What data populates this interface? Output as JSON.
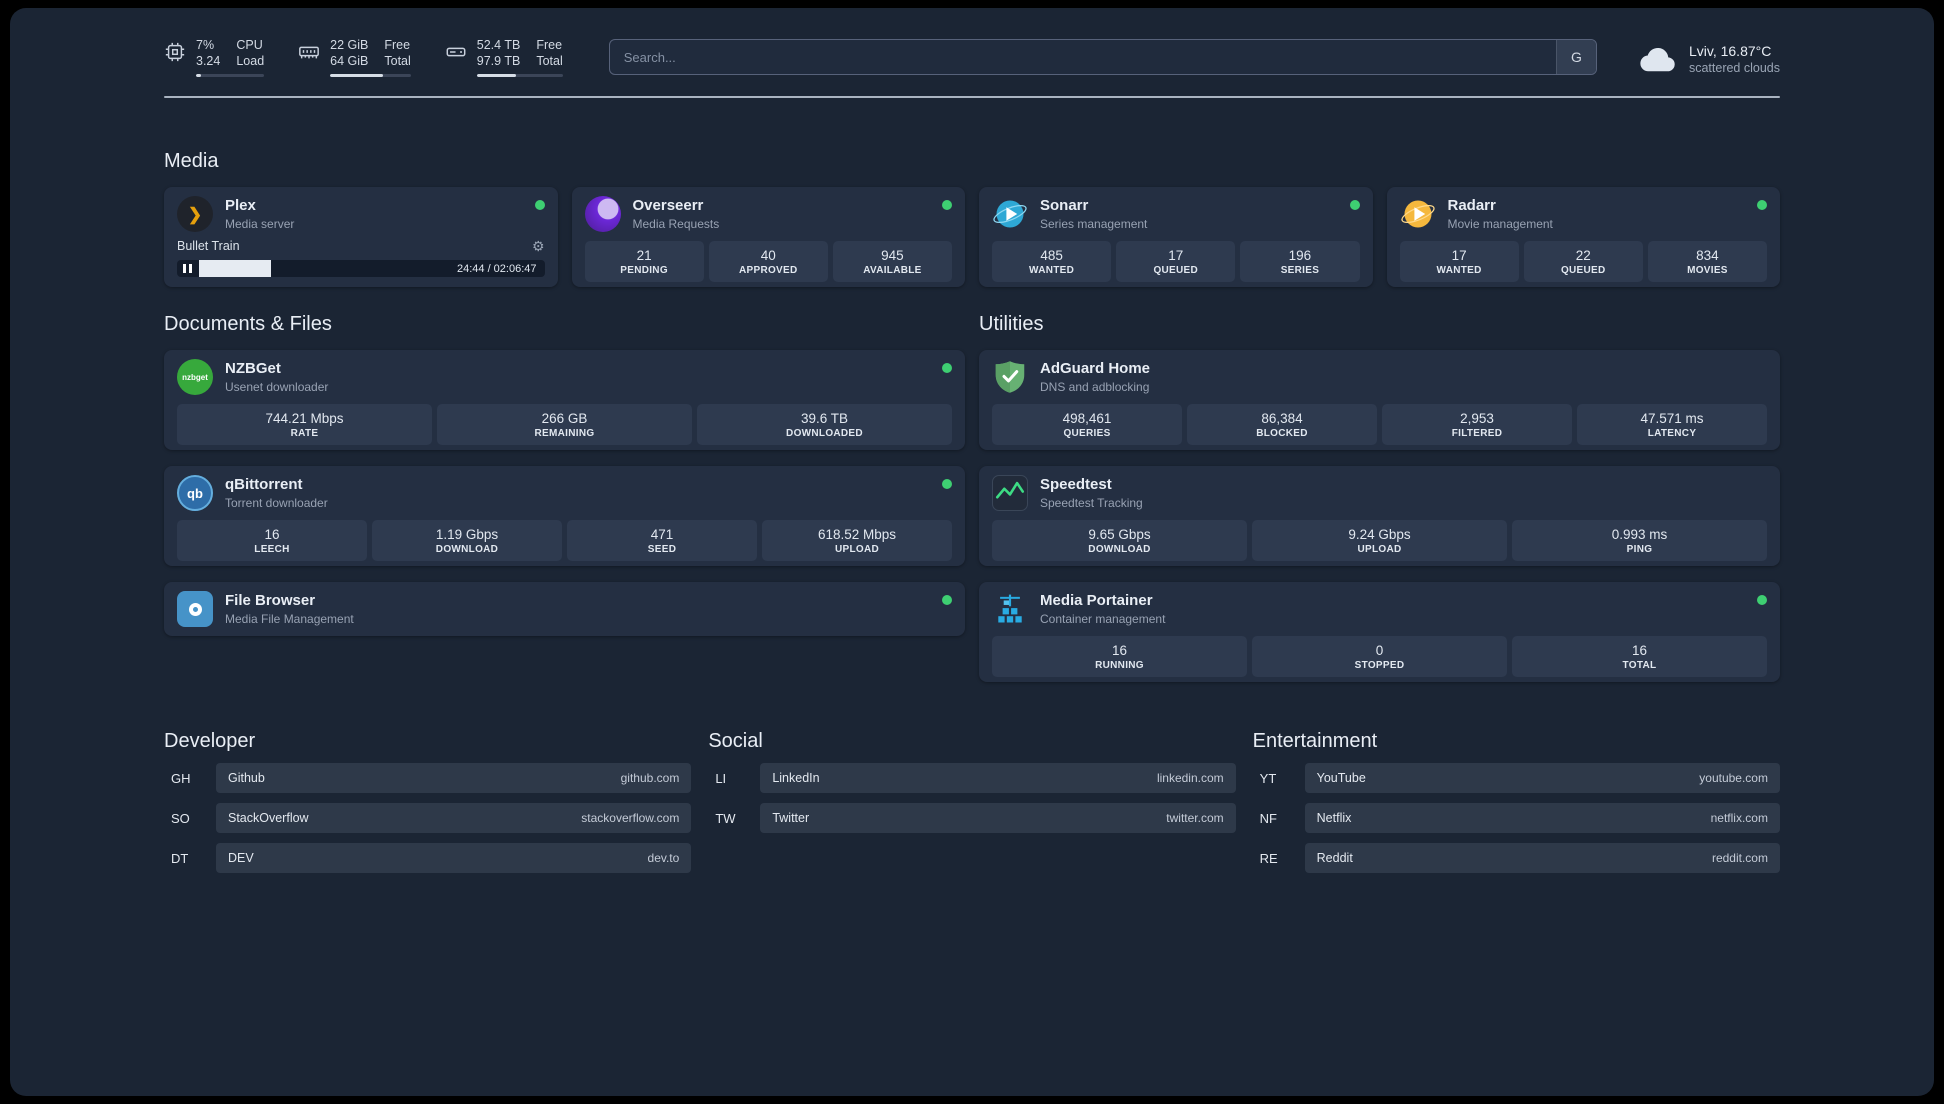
{
  "topbar": {
    "cpu": {
      "value_top": "7%",
      "value_bottom": "3.24",
      "label_top": "CPU",
      "label_bottom": "Load",
      "bar_percent": 7
    },
    "memory": {
      "value_top": "22 GiB",
      "value_bottom": "64 GiB",
      "label_top": "Free",
      "label_bottom": "Total",
      "bar_percent": 66
    },
    "disk": {
      "value_top": "52.4 TB",
      "value_bottom": "97.9 TB",
      "label_top": "Free",
      "label_bottom": "Total",
      "bar_percent": 46
    },
    "search": {
      "placeholder": "Search...",
      "provider_label": "G"
    },
    "weather": {
      "location": "Lviv, 16.87°C",
      "condition": "scattered clouds"
    }
  },
  "sections": {
    "media": "Media",
    "documents": "Documents & Files",
    "utilities": "Utilities",
    "developer": "Developer",
    "social": "Social",
    "entertainment": "Entertainment"
  },
  "services": {
    "plex": {
      "name": "Plex",
      "subtitle": "Media server",
      "now_playing": "Bullet Train",
      "time": "24:44 / 02:06:47",
      "progress_percent": 19.5
    },
    "overseerr": {
      "name": "Overseerr",
      "subtitle": "Media Requests",
      "stats": [
        {
          "value": "21",
          "label": "PENDING"
        },
        {
          "value": "40",
          "label": "APPROVED"
        },
        {
          "value": "945",
          "label": "AVAILABLE"
        }
      ]
    },
    "sonarr": {
      "name": "Sonarr",
      "subtitle": "Series management",
      "stats": [
        {
          "value": "485",
          "label": "WANTED"
        },
        {
          "value": "17",
          "label": "QUEUED"
        },
        {
          "value": "196",
          "label": "SERIES"
        }
      ]
    },
    "radarr": {
      "name": "Radarr",
      "subtitle": "Movie management",
      "stats": [
        {
          "value": "17",
          "label": "WANTED"
        },
        {
          "value": "22",
          "label": "QUEUED"
        },
        {
          "value": "834",
          "label": "MOVIES"
        }
      ]
    },
    "nzbget": {
      "name": "NZBGet",
      "subtitle": "Usenet downloader",
      "icon_text": "nzbget",
      "stats": [
        {
          "value": "744.21 Mbps",
          "label": "RATE"
        },
        {
          "value": "266 GB",
          "label": "REMAINING"
        },
        {
          "value": "39.6 TB",
          "label": "DOWNLOADED"
        }
      ]
    },
    "qbittorrent": {
      "name": "qBittorrent",
      "subtitle": "Torrent downloader",
      "icon_text": "qb",
      "stats": [
        {
          "value": "16",
          "label": "LEECH"
        },
        {
          "value": "1.19 Gbps",
          "label": "DOWNLOAD"
        },
        {
          "value": "471",
          "label": "SEED"
        },
        {
          "value": "618.52 Mbps",
          "label": "UPLOAD"
        }
      ]
    },
    "filebrowser": {
      "name": "File Browser",
      "subtitle": "Media File Management"
    },
    "adguard": {
      "name": "AdGuard Home",
      "subtitle": "DNS and adblocking",
      "stats": [
        {
          "value": "498,461",
          "label": "QUERIES"
        },
        {
          "value": "86,384",
          "label": "BLOCKED"
        },
        {
          "value": "2,953",
          "label": "FILTERED"
        },
        {
          "value": "47.571 ms",
          "label": "LATENCY"
        }
      ]
    },
    "speedtest": {
      "name": "Speedtest",
      "subtitle": "Speedtest Tracking",
      "stats": [
        {
          "value": "9.65 Gbps",
          "label": "DOWNLOAD"
        },
        {
          "value": "9.24 Gbps",
          "label": "UPLOAD"
        },
        {
          "value": "0.993 ms",
          "label": "PING"
        }
      ]
    },
    "portainer": {
      "name": "Media Portainer",
      "subtitle": "Container management",
      "stats": [
        {
          "value": "16",
          "label": "RUNNING"
        },
        {
          "value": "0",
          "label": "STOPPED"
        },
        {
          "value": "16",
          "label": "TOTAL"
        }
      ]
    }
  },
  "bookmarks": {
    "developer": [
      {
        "abbr": "GH",
        "name": "Github",
        "url": "github.com"
      },
      {
        "abbr": "SO",
        "name": "StackOverflow",
        "url": "stackoverflow.com"
      },
      {
        "abbr": "DT",
        "name": "DEV",
        "url": "dev.to"
      }
    ],
    "social": [
      {
        "abbr": "LI",
        "name": "LinkedIn",
        "url": "linkedin.com"
      },
      {
        "abbr": "TW",
        "name": "Twitter",
        "url": "twitter.com"
      }
    ],
    "entertainment": [
      {
        "abbr": "YT",
        "name": "YouTube",
        "url": "youtube.com"
      },
      {
        "abbr": "NF",
        "name": "Netflix",
        "url": "netflix.com"
      },
      {
        "abbr": "RE",
        "name": "Reddit",
        "url": "reddit.com"
      }
    ]
  },
  "colors": {
    "status_online": "#3ecf72",
    "plex_amber": "#e5a00d",
    "overseerr_purple": "#6d28d9",
    "sonarr_blue": "#2ea8d5",
    "radarr_yellow": "#f5b83d",
    "nzbget_green": "#37a93c",
    "qbittorrent_blue": "#64aede",
    "adguard_green": "#67b173",
    "speedtest_green": "#3ddc84",
    "portainer_blue": "#29abe2",
    "filebrowser_blue": "#4693c8"
  }
}
